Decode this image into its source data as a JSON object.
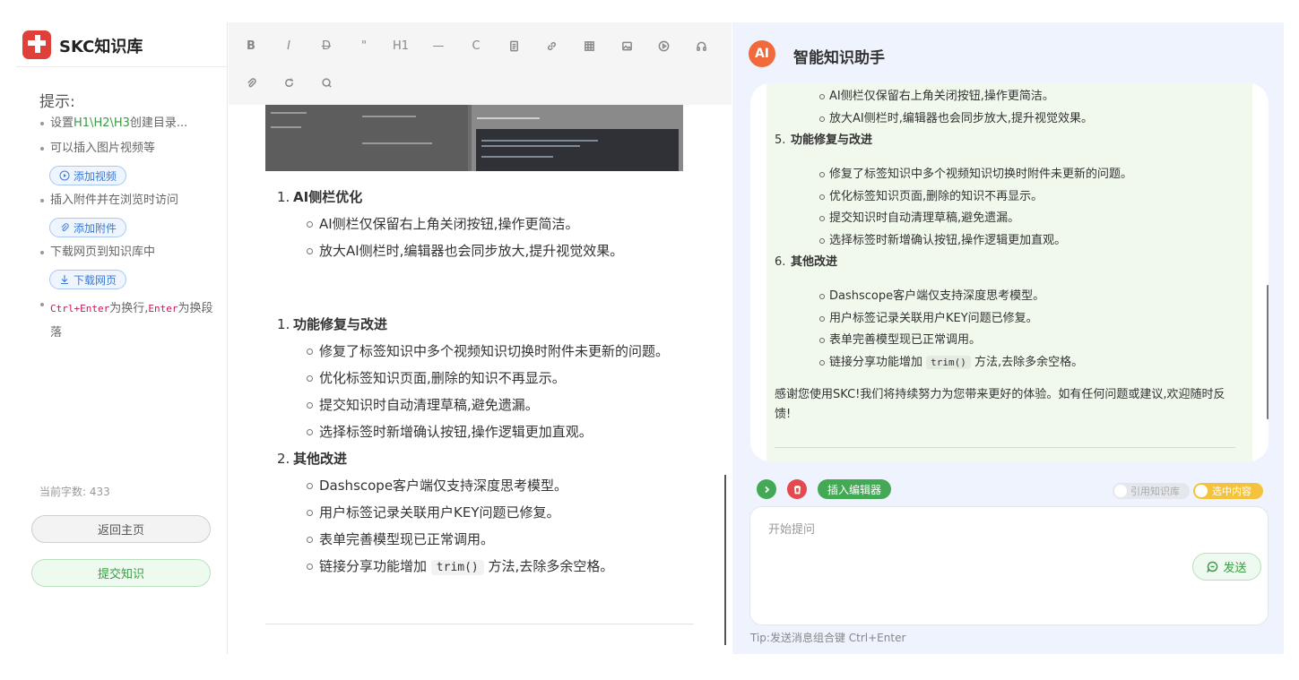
{
  "brand": {
    "name": "SKC知识库"
  },
  "sidebar": {
    "tips_title": "提示:",
    "tips": [
      {
        "prefix": "设置",
        "highlight": "H1\\H2\\H3",
        "suffix": "创建目录..."
      },
      {
        "text": "可以插入图片视频等"
      },
      {
        "text": "插入附件并在浏览时访问"
      },
      {
        "text": "下载网页到知识库中"
      },
      {
        "code1": "Ctrl+Enter",
        "mid": "为换行,",
        "code2": "Enter",
        "end": "为换段落"
      }
    ],
    "add_video_label": "添加视频",
    "add_attachment_label": "添加附件",
    "download_page_label": "下载网页",
    "word_count_label": "当前字数:",
    "word_count": "433",
    "home_button": "返回主页",
    "submit_button": "提交知识"
  },
  "toolbar": {
    "items": [
      "B",
      "I",
      "D",
      "\"",
      "H1",
      "—",
      "C"
    ]
  },
  "editor": {
    "sections": [
      {
        "num": "1.",
        "title": "AI侧栏优化",
        "items": [
          "AI侧栏仅保留右上角关闭按钮,操作更简洁。",
          "放大AI侧栏时,编辑器也会同步放大,提升视觉效果。"
        ]
      },
      {
        "num": "1.",
        "title": "功能修复与改进",
        "items": [
          "修复了标签知识中多个视频知识切换时附件未更新的问题。",
          "优化标签知识页面,删除的知识不再显示。",
          "提交知识时自动清理草稿,避免遗漏。",
          "选择标签时新增确认按钮,操作逻辑更加直观。"
        ]
      },
      {
        "num": "2.",
        "title": "其他改进",
        "items": [
          "Dashscope客户端仅支持深度思考模型。",
          "用户标签记录关联用户KEY问题已修复。",
          "表单完善模型现已正常调用。"
        ]
      }
    ],
    "last_item_prefix": "链接分享功能增加",
    "last_item_code": "trim()",
    "last_item_suffix": "方法,去除多余空格。"
  },
  "ai": {
    "badge": "AI",
    "title": "智能知识助手",
    "message": {
      "top_items": [
        "AI侧栏仅保留右上角关闭按钮,操作更简洁。",
        "放大AI侧栏时,编辑器也会同步放大,提升视觉效果。"
      ],
      "sections": [
        {
          "num": "5.",
          "title": "功能修复与改进",
          "items": [
            "修复了标签知识中多个视频知识切换时附件未更新的问题。",
            "优化标签知识页面,删除的知识不再显示。",
            "提交知识时自动清理草稿,避免遗漏。",
            "选择标签时新增确认按钮,操作逻辑更加直观。"
          ]
        },
        {
          "num": "6.",
          "title": "其他改进",
          "items": [
            "Dashscope客户端仅支持深度思考模型。",
            "用户标签记录关联用户KEY问题已修复。",
            "表单完善模型现已正常调用。"
          ]
        }
      ],
      "last_item_prefix": "链接分享功能增加",
      "last_item_code": "trim()",
      "last_item_suffix": "方法,去除多余空格。",
      "thanks": "感谢您使用SKC!我们将持续努力为您带来更好的体验。如有任何问题或建议,欢迎随时反馈!"
    },
    "insert_editor_label": "插入编辑器",
    "toggle_kb_label": "引用知识库",
    "toggle_selection_label": "选中内容",
    "ask_placeholder": "开始提问",
    "send_label": "发送",
    "tip": "Tip:发送消息组合键 Ctrl+Enter"
  },
  "colors": {
    "accent_green": "#43a955",
    "ai_badge": "#f06a3c",
    "toggle_on": "#f5c33b",
    "brand_red": "#e0403a"
  }
}
